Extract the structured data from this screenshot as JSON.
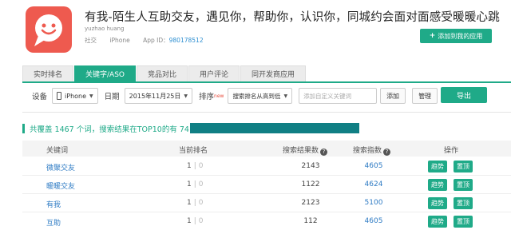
{
  "app": {
    "title": "有我-陌生人互助交友，遇见你，帮助你，认识你，同城约会面对面感受暖暖心跳",
    "developer": "yuzhao huang",
    "category": "社交",
    "platform": "iPhone",
    "app_id_label": "App ID：",
    "app_id": "980178512",
    "icon": "chat-bubble-smile-icon",
    "icon_color": "#ee5a4f",
    "add_button": "添加到我的应用"
  },
  "tabs": [
    {
      "label": "实时排名",
      "active": false
    },
    {
      "label": "关键字/ASO",
      "active": true
    },
    {
      "label": "竞品对比",
      "active": false
    },
    {
      "label": "用户评论",
      "active": false
    },
    {
      "label": "同开发商应用",
      "active": false
    }
  ],
  "filters": {
    "device_label": "设备",
    "device_value": "iPhone",
    "date_label": "日期",
    "date_value": "2015年11月25日",
    "sort_label": "排序",
    "sort_badge": "new",
    "sort_value": "搜索排名从高到低",
    "keyword_placeholder": "添加自定义关键词",
    "add_button": "添加",
    "manage_button": "管理",
    "export_button": "导出"
  },
  "summary": "共覆盖 1467 个词，搜索结果在TOP10的有 74 个",
  "table": {
    "headers": {
      "keyword": "关键词",
      "rank": "当前排名",
      "results": "搜索结果数",
      "index": "搜索指数",
      "action": "操作"
    },
    "rows": [
      {
        "keyword": "微聚交友",
        "rank": "1",
        "change": "0",
        "results": "2143",
        "index": "4605",
        "trend": "趋势",
        "top": "置顶"
      },
      {
        "keyword": "暖暖交友",
        "rank": "1",
        "change": "0",
        "results": "1122",
        "index": "4624",
        "trend": "趋势",
        "top": "置顶"
      },
      {
        "keyword": "有我",
        "rank": "1",
        "change": "0",
        "results": "2123",
        "index": "5100",
        "trend": "趋势",
        "top": "置顶"
      },
      {
        "keyword": "互助",
        "rank": "1",
        "change": "0",
        "results": "112",
        "index": "4605",
        "trend": "趋势",
        "top": "置顶"
      }
    ]
  },
  "colors": {
    "accent": "#1faa88",
    "link": "#2e7bc4",
    "redaction": "#107f84"
  }
}
